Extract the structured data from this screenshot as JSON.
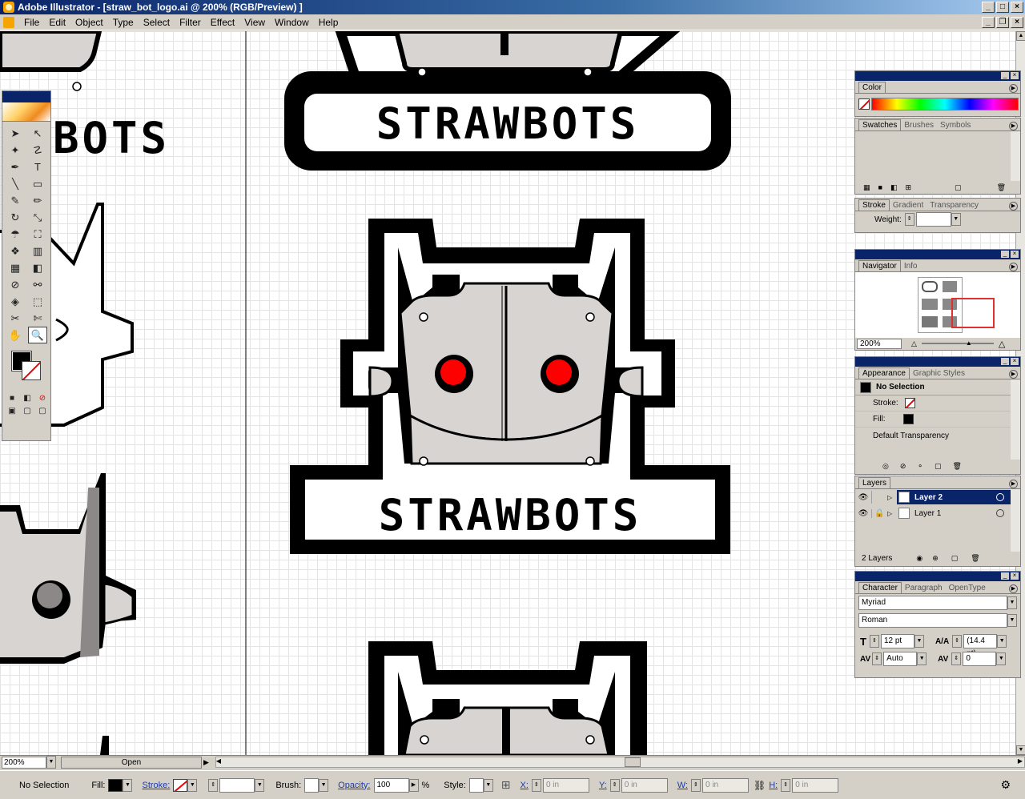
{
  "window": {
    "title": "Adobe Illustrator - [straw_bot_logo.ai @ 200% (RGB/Preview) ]"
  },
  "menu": [
    "File",
    "Edit",
    "Object",
    "Type",
    "Select",
    "Filter",
    "Effect",
    "View",
    "Window",
    "Help"
  ],
  "canvas": {
    "logo_text": "STRAWBOTS",
    "partial_logo_text": "BOTS"
  },
  "status": {
    "zoom": "200%",
    "state": "Open"
  },
  "control_bar": {
    "selection": "No Selection",
    "fill_label": "Fill:",
    "stroke_label": "Stroke:",
    "brush_label": "Brush:",
    "opacity_label": "Opacity:",
    "opacity_value": "100",
    "percent": "%",
    "style_label": "Style:",
    "x_label": "X:",
    "x_value": "0 in",
    "y_label": "Y:",
    "y_value": "0 in",
    "w_label": "W:",
    "w_value": "0 in",
    "h_label": "H:",
    "h_value": "0 in"
  },
  "panels": {
    "color": {
      "tab": "Color"
    },
    "swatches": {
      "tabs": [
        "Swatches",
        "Brushes",
        "Symbols"
      ]
    },
    "stroke": {
      "tabs": [
        "Stroke",
        "Gradient",
        "Transparency"
      ],
      "weight_label": "Weight:"
    },
    "navigator": {
      "tabs": [
        "Navigator",
        "Info"
      ],
      "zoom": "200%"
    },
    "appearance": {
      "tabs": [
        "Appearance",
        "Graphic Styles"
      ],
      "selection": "No Selection",
      "stroke_label": "Stroke:",
      "fill_label": "Fill:",
      "transparency": "Default Transparency"
    },
    "layers": {
      "tab": "Layers",
      "items": [
        "Layer 2",
        "Layer 1"
      ],
      "count": "2 Layers"
    },
    "character": {
      "tabs": [
        "Character",
        "Paragraph",
        "OpenType"
      ],
      "font": "Myriad",
      "style": "Roman",
      "size": "12 pt",
      "leading": "(14.4 pt)",
      "kerning": "Auto",
      "tracking": "0"
    }
  },
  "colors": {
    "titlebar": "#0a246a",
    "bot_gray": "#d8d4d2",
    "bot_dark_gray": "#8c8888",
    "eye_red": "#ff0000"
  }
}
